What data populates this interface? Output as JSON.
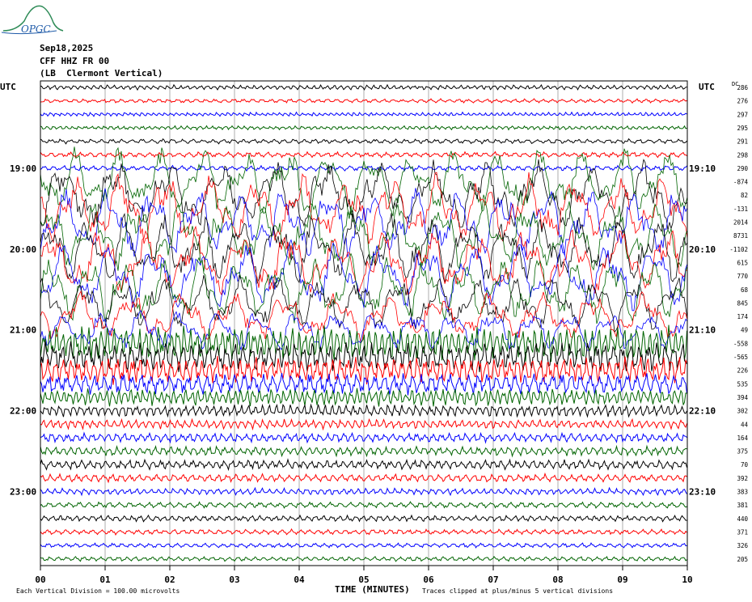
{
  "logo": {
    "text": "OPGC"
  },
  "header": {
    "date": "Sep18,2025",
    "station": "CFF HHZ FR 00",
    "location": "(LB  Clermont Vertical)"
  },
  "chart_data": {
    "type": "line",
    "title": "",
    "left_axis_label": "UTC",
    "right_axis_label": "UTC",
    "dc_label": "DC",
    "xlabel": "TIME (MINUTES)",
    "x_ticks": [
      "00",
      "01",
      "02",
      "03",
      "04",
      "05",
      "06",
      "07",
      "08",
      "09",
      "10"
    ],
    "xlim": [
      0,
      10
    ],
    "left_time_labels": [
      {
        "row": 6,
        "label": "19:00"
      },
      {
        "row": 12,
        "label": "20:00"
      },
      {
        "row": 18,
        "label": "21:00"
      },
      {
        "row": 24,
        "label": "22:00"
      },
      {
        "row": 30,
        "label": "23:00"
      }
    ],
    "right_time_labels": [
      {
        "row": 6,
        "label": "19:10"
      },
      {
        "row": 12,
        "label": "20:10"
      },
      {
        "row": 18,
        "label": "21:10"
      },
      {
        "row": 24,
        "label": "22:10"
      },
      {
        "row": 30,
        "label": "23:10"
      }
    ],
    "trace_colors": [
      "#000000",
      "#ff0000",
      "#0000ff",
      "#006400"
    ],
    "traces": [
      {
        "dc": "286",
        "amplitude": 0.35
      },
      {
        "dc": "276",
        "amplitude": 0.3
      },
      {
        "dc": "297",
        "amplitude": 0.3
      },
      {
        "dc": "295",
        "amplitude": 0.3
      },
      {
        "dc": "291",
        "amplitude": 0.35
      },
      {
        "dc": "298",
        "amplitude": 0.4
      },
      {
        "dc": "290",
        "amplitude": 0.4
      },
      {
        "dc": "-874",
        "amplitude": 5
      },
      {
        "dc": "82",
        "amplitude": 5
      },
      {
        "dc": "-131",
        "amplitude": 5
      },
      {
        "dc": "2014",
        "amplitude": 5
      },
      {
        "dc": "8731",
        "amplitude": 5
      },
      {
        "dc": "-1102",
        "amplitude": 5
      },
      {
        "dc": "615",
        "amplitude": 5
      },
      {
        "dc": "770",
        "amplitude": 5
      },
      {
        "dc": "68",
        "amplitude": 5
      },
      {
        "dc": "845",
        "amplitude": 4
      },
      {
        "dc": "174",
        "amplitude": 3.5
      },
      {
        "dc": "49",
        "amplitude": 3
      },
      {
        "dc": "-558",
        "amplitude": 2.6
      },
      {
        "dc": "-565",
        "amplitude": 2.2
      },
      {
        "dc": "226",
        "amplitude": 2
      },
      {
        "dc": "535",
        "amplitude": 1.6
      },
      {
        "dc": "394",
        "amplitude": 1.3
      },
      {
        "dc": "302",
        "amplitude": 0.9
      },
      {
        "dc": "44",
        "amplitude": 0.7
      },
      {
        "dc": "164",
        "amplitude": 0.7
      },
      {
        "dc": "375",
        "amplitude": 0.7
      },
      {
        "dc": "70",
        "amplitude": 0.7
      },
      {
        "dc": "392",
        "amplitude": 0.6
      },
      {
        "dc": "383",
        "amplitude": 0.5
      },
      {
        "dc": "381",
        "amplitude": 0.45
      },
      {
        "dc": "440",
        "amplitude": 0.45
      },
      {
        "dc": "371",
        "amplitude": 0.4
      },
      {
        "dc": "326",
        "amplitude": 0.35
      },
      {
        "dc": "205",
        "amplitude": 0.35
      }
    ],
    "grid": true,
    "legend": "none"
  },
  "footer": {
    "scale_note": "Each Vertical Division =  100.00 microvolts",
    "clip_note": "Traces clipped at plus/minus 5 vertical divisions"
  }
}
